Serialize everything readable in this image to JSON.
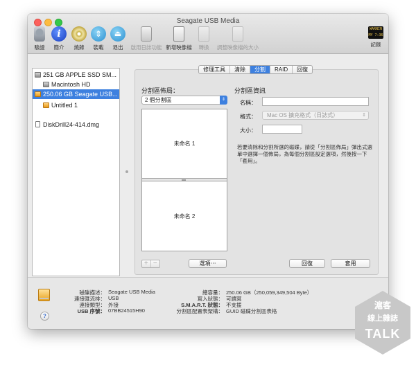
{
  "window": {
    "title": "Seagate USB Media"
  },
  "toolbar": {
    "items": [
      {
        "label": "驗證",
        "icon": "verify-icon",
        "enabled": true
      },
      {
        "label": "簡介",
        "icon": "info-icon",
        "glyph": "i",
        "enabled": true
      },
      {
        "label": "燒錄",
        "icon": "burn-icon",
        "enabled": true
      },
      {
        "label": "裝載",
        "icon": "mount-icon",
        "glyph": "⇕",
        "enabled": true
      },
      {
        "label": "退出",
        "icon": "eject-icon",
        "glyph": "⏏",
        "enabled": true
      },
      {
        "label": "啟用日誌功能",
        "icon": "log-icon",
        "enabled": false
      },
      {
        "label": "新增映像檔",
        "icon": "new-image-icon",
        "enabled": true
      },
      {
        "label": "轉換",
        "icon": "convert-icon",
        "enabled": false
      },
      {
        "label": "調整映像檔的大小",
        "icon": "resize-image-icon",
        "enabled": false
      }
    ],
    "record": {
      "label": "記錄",
      "icon": "record-icon",
      "glyph": "WARNIN\nMY 7:36"
    }
  },
  "sidebar": {
    "items": [
      {
        "label": "251 GB APPLE SSD SM...",
        "type": "disk",
        "selected": false,
        "indent": 0
      },
      {
        "label": "Macintosh HD",
        "type": "volume",
        "selected": false,
        "indent": 1
      },
      {
        "label": "250.06 GB Seagate USB...",
        "type": "external-disk",
        "selected": true,
        "indent": 0
      },
      {
        "label": "Untitled 1",
        "type": "external-volume",
        "selected": false,
        "indent": 1
      },
      {
        "label": "DiskDrill24-414.dmg",
        "type": "image",
        "selected": false,
        "indent": 0
      }
    ]
  },
  "tabs": [
    {
      "label": "修理工具",
      "active": false
    },
    {
      "label": "清除",
      "active": false
    },
    {
      "label": "分割",
      "active": true
    },
    {
      "label": "RAID",
      "active": false
    },
    {
      "label": "回復",
      "active": false
    }
  ],
  "partition": {
    "layout_title": "分割區佈局：",
    "layout_value": "2 個分割區",
    "partitions": [
      "未命名 1",
      "未命名 2"
    ],
    "plus": "+",
    "minus": "−",
    "options_button": "選項⋯",
    "info_title": "分割區資訊",
    "name_label": "名稱：",
    "name_value": "",
    "format_label": "格式：",
    "format_value": "Mac OS 擴充格式（日誌式）",
    "size_label": "大小：",
    "size_value": "",
    "description": "若要清除和分割所選的磁碟，請從「分割區佈局」彈出式選單中選擇一個佈局，為每個分割區設定選項，然後按一下「套用」。",
    "revert_button": "回復",
    "apply_button": "套用"
  },
  "info": {
    "left": [
      {
        "key": "磁碟描述：",
        "value": "Seagate USB Media",
        "bold": false
      },
      {
        "key": "連接匯流排：",
        "value": "USB",
        "bold": false
      },
      {
        "key": "連接類型：",
        "value": "外接",
        "bold": false
      },
      {
        "key": "USB 序號：",
        "value": "07BB24515H90",
        "bold": true
      }
    ],
    "right": [
      {
        "key": "總容量：",
        "value": "250.06 GB（250,059,349,504 Byte）",
        "bold": false
      },
      {
        "key": "寫入狀態：",
        "value": "可讀寫",
        "bold": false
      },
      {
        "key": "S.M.A.R.T. 狀態：",
        "value": "不支援",
        "bold": true
      },
      {
        "key": "分割區配置表架構：",
        "value": "GUID 磁碟分割區表格",
        "bold": false
      }
    ],
    "help": "?"
  },
  "watermark": {
    "line1": "滬客",
    "line2": "線上雜誌",
    "line3": "TALK"
  }
}
